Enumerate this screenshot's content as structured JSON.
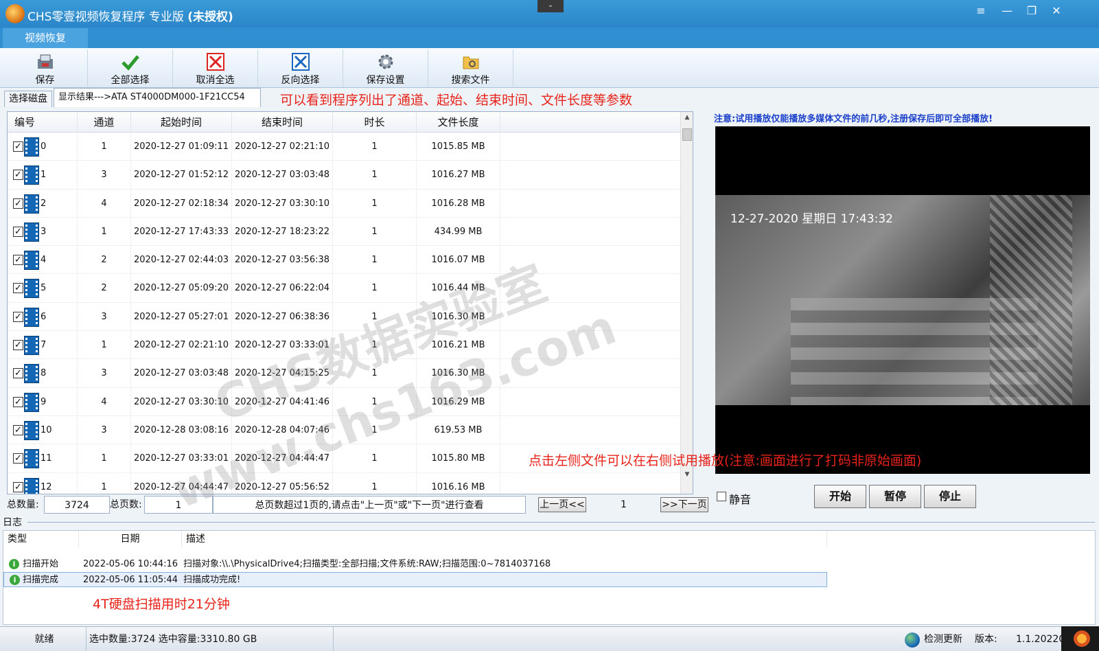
{
  "window": {
    "title_plain": "CHS零壹视频恢复程序 专业版",
    "title_bold": "(未授权)",
    "controls": [
      "≡",
      "—",
      "❐",
      "✕"
    ]
  },
  "ribbon": {
    "tab_label": "视频恢复"
  },
  "toolbar": {
    "buttons": [
      {
        "label": "保存",
        "icon": "save-disk-icon"
      },
      {
        "label": "全部选择",
        "icon": "green-check-icon"
      },
      {
        "label": "取消全选",
        "icon": "red-x-box-icon"
      },
      {
        "label": "反向选择",
        "icon": "blue-x-box-icon"
      },
      {
        "label": "保存设置",
        "icon": "settings-gear-icon"
      },
      {
        "label": "搜索文件",
        "icon": "folder-search-icon"
      }
    ]
  },
  "tabs": {
    "disk": "选择磁盘",
    "result": "显示结果--->ATA    ST4000DM000-1F21CC54"
  },
  "annotations": {
    "top": "可以看到程序列出了通道、起始、结束时间、文件长度等参数",
    "preview": "点击左侧文件可以在右侧试用播放(注意:画面进行了打码非原始画面)",
    "log": "4T硬盘扫描用时21分钟"
  },
  "table": {
    "columns": [
      "编号",
      "通道",
      "起始时间",
      "结束时间",
      "时长",
      "文件长度"
    ],
    "rows": [
      {
        "id": "0",
        "channel": "1",
        "start": "2020-12-27 01:09:11",
        "end": "2020-12-27 02:21:10",
        "duration": "1",
        "size": "1015.85 MB"
      },
      {
        "id": "1",
        "channel": "3",
        "start": "2020-12-27 01:52:12",
        "end": "2020-12-27 03:03:48",
        "duration": "1",
        "size": "1016.27 MB"
      },
      {
        "id": "2",
        "channel": "4",
        "start": "2020-12-27 02:18:34",
        "end": "2020-12-27 03:30:10",
        "duration": "1",
        "size": "1016.28 MB"
      },
      {
        "id": "3",
        "channel": "1",
        "start": "2020-12-27 17:43:33",
        "end": "2020-12-27 18:23:22",
        "duration": "1",
        "size": "434.99 MB"
      },
      {
        "id": "4",
        "channel": "2",
        "start": "2020-12-27 02:44:03",
        "end": "2020-12-27 03:56:38",
        "duration": "1",
        "size": "1016.07 MB"
      },
      {
        "id": "5",
        "channel": "2",
        "start": "2020-12-27 05:09:20",
        "end": "2020-12-27 06:22:04",
        "duration": "1",
        "size": "1016.44 MB"
      },
      {
        "id": "6",
        "channel": "3",
        "start": "2020-12-27 05:27:01",
        "end": "2020-12-27 06:38:36",
        "duration": "1",
        "size": "1016.30 MB"
      },
      {
        "id": "7",
        "channel": "1",
        "start": "2020-12-27 02:21:10",
        "end": "2020-12-27 03:33:01",
        "duration": "1",
        "size": "1016.21 MB"
      },
      {
        "id": "8",
        "channel": "3",
        "start": "2020-12-27 03:03:48",
        "end": "2020-12-27 04:15:25",
        "duration": "1",
        "size": "1016.30 MB"
      },
      {
        "id": "9",
        "channel": "4",
        "start": "2020-12-27 03:30:10",
        "end": "2020-12-27 04:41:46",
        "duration": "1",
        "size": "1016.29 MB"
      },
      {
        "id": "10",
        "channel": "3",
        "start": "2020-12-28 03:08:16",
        "end": "2020-12-28 04:07:46",
        "duration": "1",
        "size": "619.53 MB"
      },
      {
        "id": "11",
        "channel": "1",
        "start": "2020-12-27 03:33:01",
        "end": "2020-12-27 04:44:47",
        "duration": "1",
        "size": "1015.80 MB"
      },
      {
        "id": "12",
        "channel": "1",
        "start": "2020-12-27 04:44:47",
        "end": "2020-12-27 05:56:52",
        "duration": "1",
        "size": "1016.16 MB"
      }
    ]
  },
  "footer": {
    "total_label": "总数量:",
    "total_value": "3724",
    "pages_label": "总页数:",
    "pages_value": "1",
    "hint": "总页数超过1页的,请点击\"上一页\"或\"下一页\"进行查看",
    "prev_label": "上一页<<",
    "page_current": "1",
    "next_label": ">>下一页"
  },
  "preview": {
    "notice": "注意:试用播放仅能播放多媒体文件的前几秒,注册保存后即可全部播放!",
    "osd": "12-27-2020  星期日  17:43:32",
    "mute_label": "静音",
    "start_label": "开始",
    "pause_label": "暂停",
    "stop_label": "停止"
  },
  "log": {
    "title": "日志",
    "columns": [
      "类型",
      "日期",
      "描述"
    ],
    "rows": [
      {
        "type": "扫描开始",
        "date": "2022-05-06 10:44:16",
        "desc": "扫描对象:\\\\.\\PhysicalDrive4;扫描类型:全部扫描;文件系统:RAW;扫描范围:0~7814037168"
      },
      {
        "type": "扫描完成",
        "date": "2022-05-06 11:05:44",
        "desc": "扫描成功完成!"
      }
    ]
  },
  "status": {
    "ready": "就绪",
    "selection": "选中数量:3724 选中容量:3310.80 GB",
    "update": "检测更新",
    "version_label": "版本:",
    "version_value": "1.1.20220"
  },
  "watermark": {
    "line1": "CHS数据实验室",
    "line2": "www.chs163.com"
  },
  "colors": {
    "title_bar": "#2a86c8",
    "annotation_red": "#e8231a",
    "notice_blue": "#1a3fc9"
  }
}
